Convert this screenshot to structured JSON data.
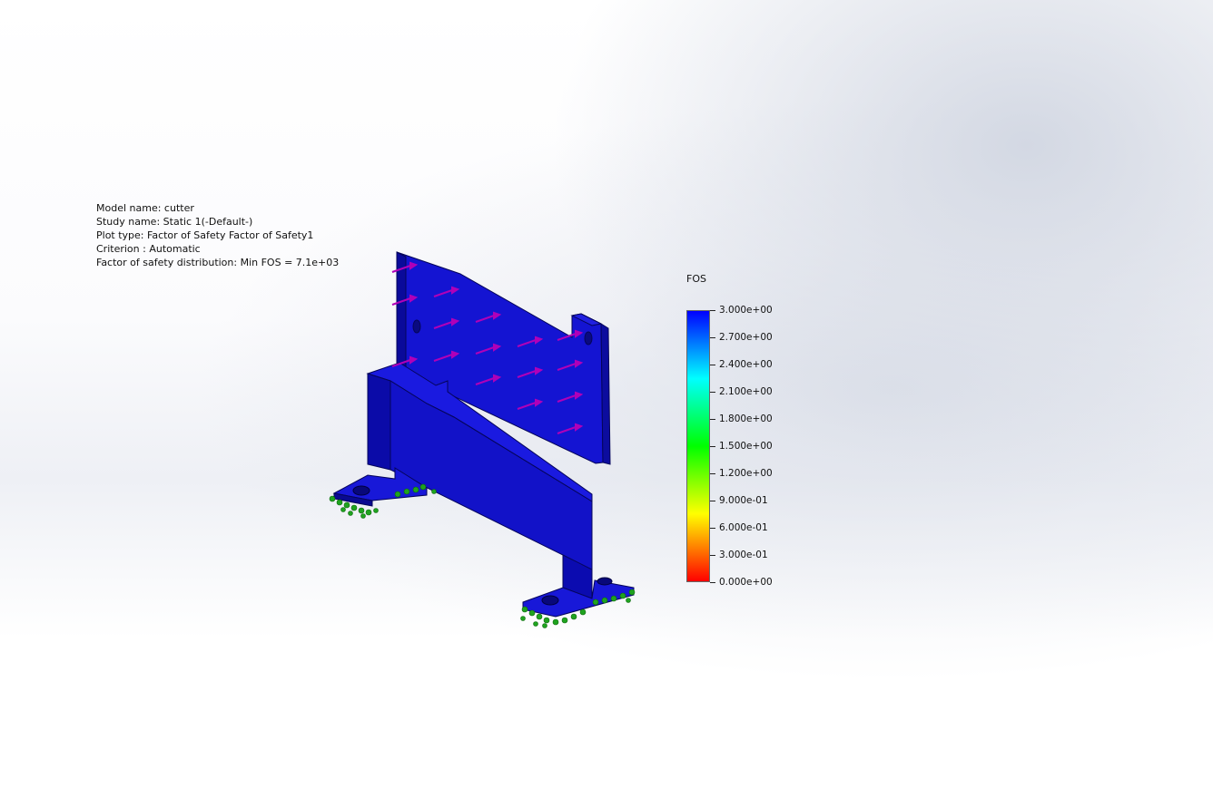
{
  "study_info": {
    "model_name": "Model name: cutter",
    "study_name": "Study name: Static 1(-Default-)",
    "plot_type": "Plot type: Factor of Safety Factor of Safety1",
    "criterion": "Criterion : Automatic",
    "fos_distribution": "Factor of safety distribution: Min FOS = 7.1e+03"
  },
  "legend": {
    "title": "FOS",
    "gradient": [
      "#0000ff",
      "#0080ff",
      "#00ffff",
      "#00ff80",
      "#00ff00",
      "#80ff00",
      "#ffff00",
      "#ff8000",
      "#ff0000"
    ],
    "ticks": [
      "3.000e+00",
      "2.700e+00",
      "2.400e+00",
      "2.100e+00",
      "1.800e+00",
      "1.500e+00",
      "1.200e+00",
      "9.000e-01",
      "6.000e-01",
      "3.000e-01",
      "0.000e+00"
    ]
  },
  "model": {
    "part_color": "#1010d8",
    "edge_color": "#05055a",
    "load_arrow_color": "#b000b8",
    "fixture_color": "#1fa31f"
  }
}
